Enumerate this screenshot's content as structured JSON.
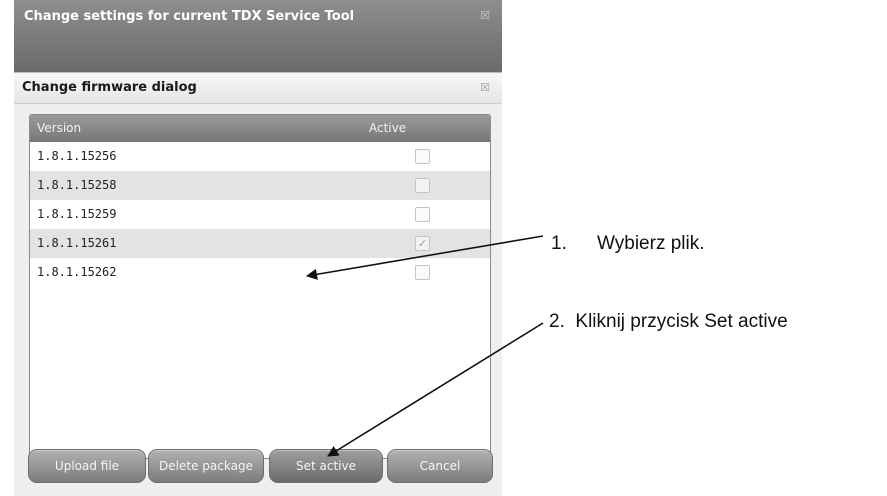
{
  "outer_window": {
    "title": "Change settings for current TDX Service Tool",
    "close_icon": "close-icon"
  },
  "dialog": {
    "title": "Change firmware dialog",
    "close_icon": "close-icon",
    "table": {
      "columns": [
        "Version",
        "Active"
      ],
      "rows": [
        {
          "version": "1.8.1.15256",
          "active": false
        },
        {
          "version": "1.8.1.15258",
          "active": false
        },
        {
          "version": "1.8.1.15259",
          "active": false
        },
        {
          "version": "1.8.1.15261",
          "active": true
        },
        {
          "version": "1.8.1.15262",
          "active": false
        }
      ]
    },
    "buttons": {
      "upload": "Upload file",
      "delete": "Delete package",
      "set_active": "Set active",
      "cancel": "Cancel"
    }
  },
  "annotations": {
    "step1_number": "1.",
    "step1_text": "Wybierz plik.",
    "step2": "2.  Kliknij przycisk Set active"
  }
}
